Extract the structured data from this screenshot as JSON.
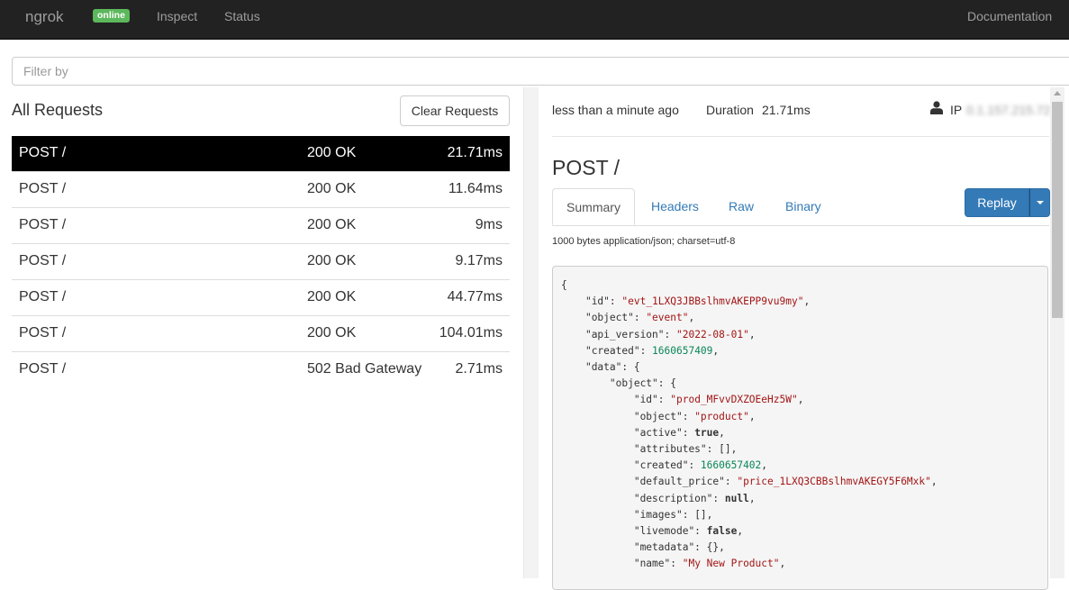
{
  "navbar": {
    "brand": "ngrok",
    "status_badge": "online",
    "links": [
      "Inspect",
      "Status"
    ],
    "documentation": "Documentation"
  },
  "filter": {
    "placeholder": "Filter by"
  },
  "requests_panel": {
    "title": "All Requests",
    "clear_button": "Clear Requests",
    "requests": [
      {
        "method": "POST /",
        "status": "200 OK",
        "duration": "21.71ms",
        "selected": true
      },
      {
        "method": "POST /",
        "status": "200 OK",
        "duration": "11.64ms"
      },
      {
        "method": "POST /",
        "status": "200 OK",
        "duration": "9ms"
      },
      {
        "method": "POST /",
        "status": "200 OK",
        "duration": "9.17ms"
      },
      {
        "method": "POST /",
        "status": "200 OK",
        "duration": "44.77ms"
      },
      {
        "method": "POST /",
        "status": "200 OK",
        "duration": "104.01ms"
      },
      {
        "method": "POST /",
        "status": "502 Bad Gateway",
        "duration": "2.71ms"
      }
    ]
  },
  "detail": {
    "time_ago": "less than a minute ago",
    "duration_label": "Duration",
    "duration_value": "21.71ms",
    "ip_label": "IP",
    "ip_value": "0.1.157.215.72",
    "title": "POST /",
    "tabs": [
      "Summary",
      "Headers",
      "Raw",
      "Binary"
    ],
    "active_tab": "Summary",
    "replay_button": "Replay",
    "content_info": "1000 bytes application/json; charset=utf-8",
    "json_lines": [
      {
        "indent": 0,
        "text": "{"
      },
      {
        "indent": 1,
        "key": "id",
        "value": "\"evt_1LXQ3JBBslhmvAKEPP9vu9my\"",
        "type": "string"
      },
      {
        "indent": 1,
        "key": "object",
        "value": "\"event\"",
        "type": "string"
      },
      {
        "indent": 1,
        "key": "api_version",
        "value": "\"2022-08-01\"",
        "type": "string"
      },
      {
        "indent": 1,
        "key": "created",
        "value": "1660657409",
        "type": "number"
      },
      {
        "indent": 1,
        "key": "data",
        "value": "{",
        "type": "open"
      },
      {
        "indent": 2,
        "key": "object",
        "value": "{",
        "type": "open"
      },
      {
        "indent": 3,
        "key": "id",
        "value": "\"prod_MFvvDXZOEeHz5W\"",
        "type": "string"
      },
      {
        "indent": 3,
        "key": "object",
        "value": "\"product\"",
        "type": "string"
      },
      {
        "indent": 3,
        "key": "active",
        "value": "true",
        "type": "keyword"
      },
      {
        "indent": 3,
        "key": "attributes",
        "value": "[]",
        "type": "plain"
      },
      {
        "indent": 3,
        "key": "created",
        "value": "1660657402",
        "type": "number"
      },
      {
        "indent": 3,
        "key": "default_price",
        "value": "\"price_1LXQ3CBBslhmvAKEGY5F6Mxk\"",
        "type": "string"
      },
      {
        "indent": 3,
        "key": "description",
        "value": "null",
        "type": "keyword"
      },
      {
        "indent": 3,
        "key": "images",
        "value": "[]",
        "type": "plain"
      },
      {
        "indent": 3,
        "key": "livemode",
        "value": "false",
        "type": "keyword"
      },
      {
        "indent": 3,
        "key": "metadata",
        "value": "{}",
        "type": "plain"
      },
      {
        "indent": 3,
        "key": "name",
        "value": "\"My New Product\"",
        "type": "string"
      }
    ]
  }
}
